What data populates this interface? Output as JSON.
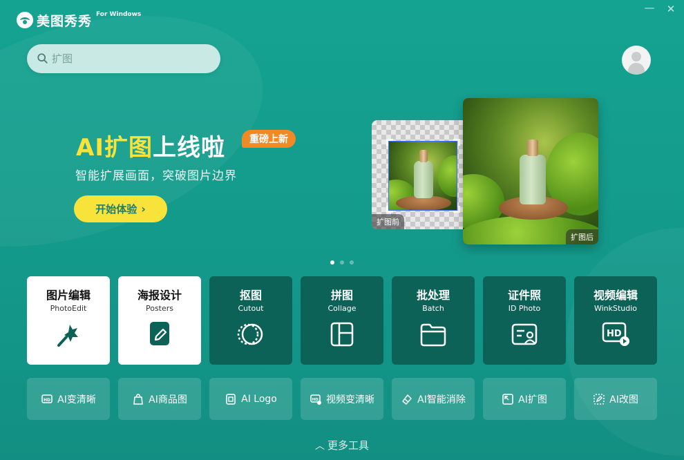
{
  "app": {
    "name": "美图秀秀",
    "subtitle": "For Windows"
  },
  "window": {
    "minimize": "—",
    "close": "✕"
  },
  "search": {
    "placeholder": "扩图"
  },
  "banner": {
    "title_highlight": "AI扩图",
    "title_rest": "上线啦",
    "badge": "重磅上新",
    "subtitle": "智能扩展画面，突破图片边界",
    "cta": "开始体验",
    "before_label": "扩图前",
    "after_label": "扩图后",
    "slides": 3,
    "active_slide": 1
  },
  "tools": [
    {
      "title": "图片编辑",
      "sub": "PhotoEdit",
      "icon": "magic-wand-icon",
      "style": "white"
    },
    {
      "title": "海报设计",
      "sub": "Posters",
      "icon": "pen-edit-icon",
      "style": "white"
    },
    {
      "title": "抠图",
      "sub": "Cutout",
      "icon": "cutout-circle-icon",
      "style": "dark"
    },
    {
      "title": "拼图",
      "sub": "Collage",
      "icon": "collage-grid-icon",
      "style": "dark"
    },
    {
      "title": "批处理",
      "sub": "Batch",
      "icon": "folder-icon",
      "style": "dark"
    },
    {
      "title": "证件照",
      "sub": "ID Photo",
      "icon": "id-card-icon",
      "style": "dark"
    },
    {
      "title": "视频编辑",
      "sub": "WinkStudio",
      "icon": "hd-video-icon",
      "style": "dark"
    }
  ],
  "quick_tools": [
    {
      "label": "AI变清晰",
      "icon": "hd-icon"
    },
    {
      "label": "AI商品图",
      "icon": "product-bag-icon"
    },
    {
      "label": "AI Logo",
      "icon": "logo-icon"
    },
    {
      "label": "视频变清晰",
      "icon": "video-hd-icon"
    },
    {
      "label": "AI智能消除",
      "icon": "eraser-icon"
    },
    {
      "label": "AI扩图",
      "icon": "expand-icon"
    },
    {
      "label": "AI改图",
      "icon": "edit-image-icon"
    }
  ],
  "footer": {
    "more": "更多工具"
  }
}
